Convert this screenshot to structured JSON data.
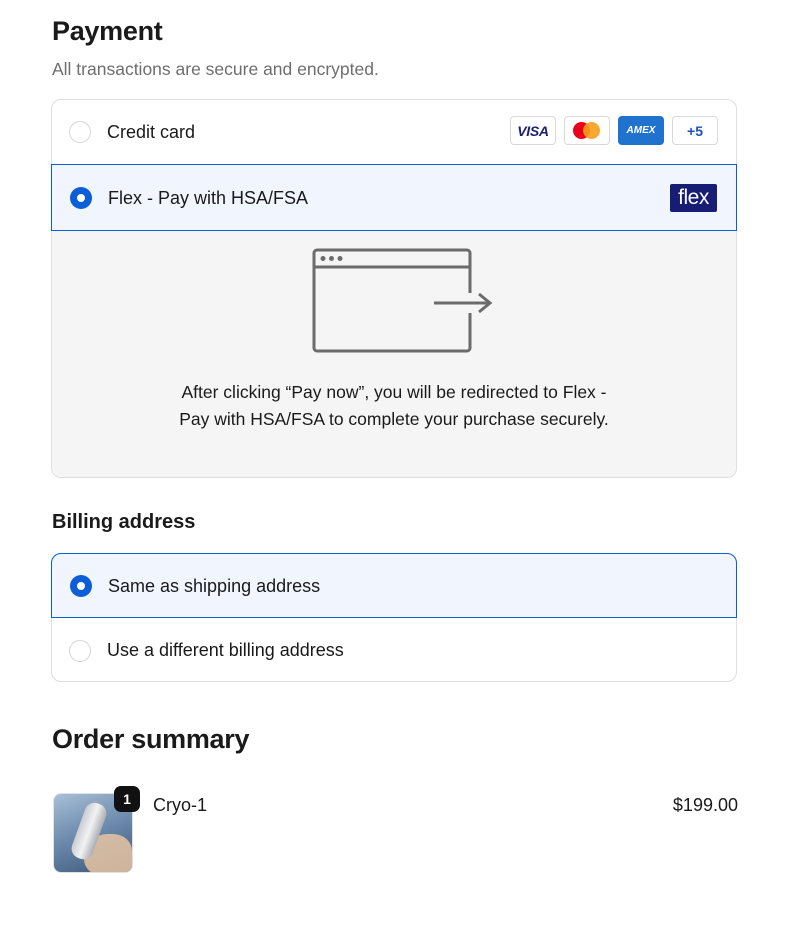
{
  "payment": {
    "title": "Payment",
    "subtitle": "All transactions are secure and encrypted.",
    "options": [
      {
        "label": "Credit card",
        "selected": false
      },
      {
        "label": "Flex - Pay with HSA/FSA",
        "selected": true
      }
    ],
    "card_brands": [
      "VISA",
      "mastercard",
      "AMEX",
      "+5"
    ],
    "flex_logo_text": "flex",
    "redirect_text": "After clicking “Pay now”, you will be redirected to Flex - Pay with HSA/FSA to complete your purchase securely.",
    "accent_color": "#0b5ed7"
  },
  "billing": {
    "title": "Billing address",
    "options": [
      {
        "label": "Same as shipping address",
        "selected": true
      },
      {
        "label": "Use a different billing address",
        "selected": false
      }
    ]
  },
  "order_summary": {
    "title": "Order summary",
    "items": [
      {
        "name": "Cryo-1",
        "quantity": "1",
        "price": "$199.00"
      }
    ]
  }
}
